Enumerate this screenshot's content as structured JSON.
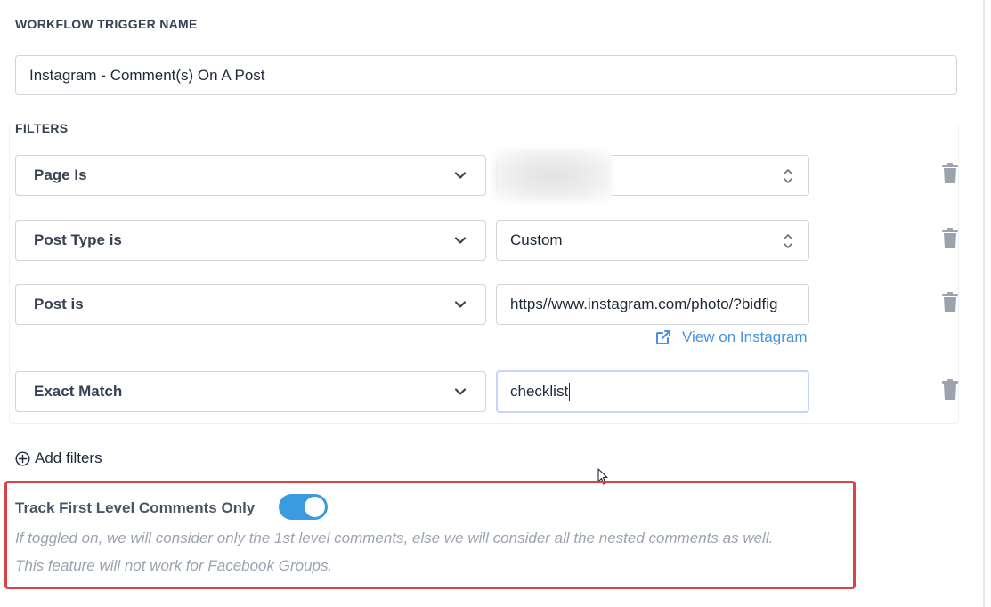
{
  "trigger": {
    "label": "WORKFLOW TRIGGER NAME",
    "value": "Instagram - Comment(s) On A Post"
  },
  "filters": {
    "label": "FILTERS",
    "rows": [
      {
        "field": "Page Is",
        "value": "",
        "value_type": "select-redacted"
      },
      {
        "field": "Post Type is",
        "value": "Custom",
        "value_type": "select"
      },
      {
        "field": "Post is",
        "value": "https//www.instagram.com/photo/?bidfig",
        "value_type": "text"
      },
      {
        "field": "Exact Match",
        "value": "checklist",
        "value_type": "text-focused"
      }
    ],
    "view_link": "View on Instagram",
    "add_label": "Add filters"
  },
  "toggle": {
    "label": "Track First Level Comments Only",
    "on": true,
    "help_line_1": "If toggled on, we will consider only the 1st level comments, else we will consider all the nested comments as well.",
    "help_line_2": "This feature will not work for Facebook Groups."
  },
  "colors": {
    "toggle_on": "#3b9be0",
    "link": "#4a90e2",
    "highlight_border": "#d94343",
    "trash": "#9ca3af"
  },
  "icons": [
    "chevron-down-icon",
    "up-down-arrows-icon",
    "trash-icon",
    "external-link-icon",
    "plus-circle-icon",
    "mouse-cursor-icon"
  ]
}
